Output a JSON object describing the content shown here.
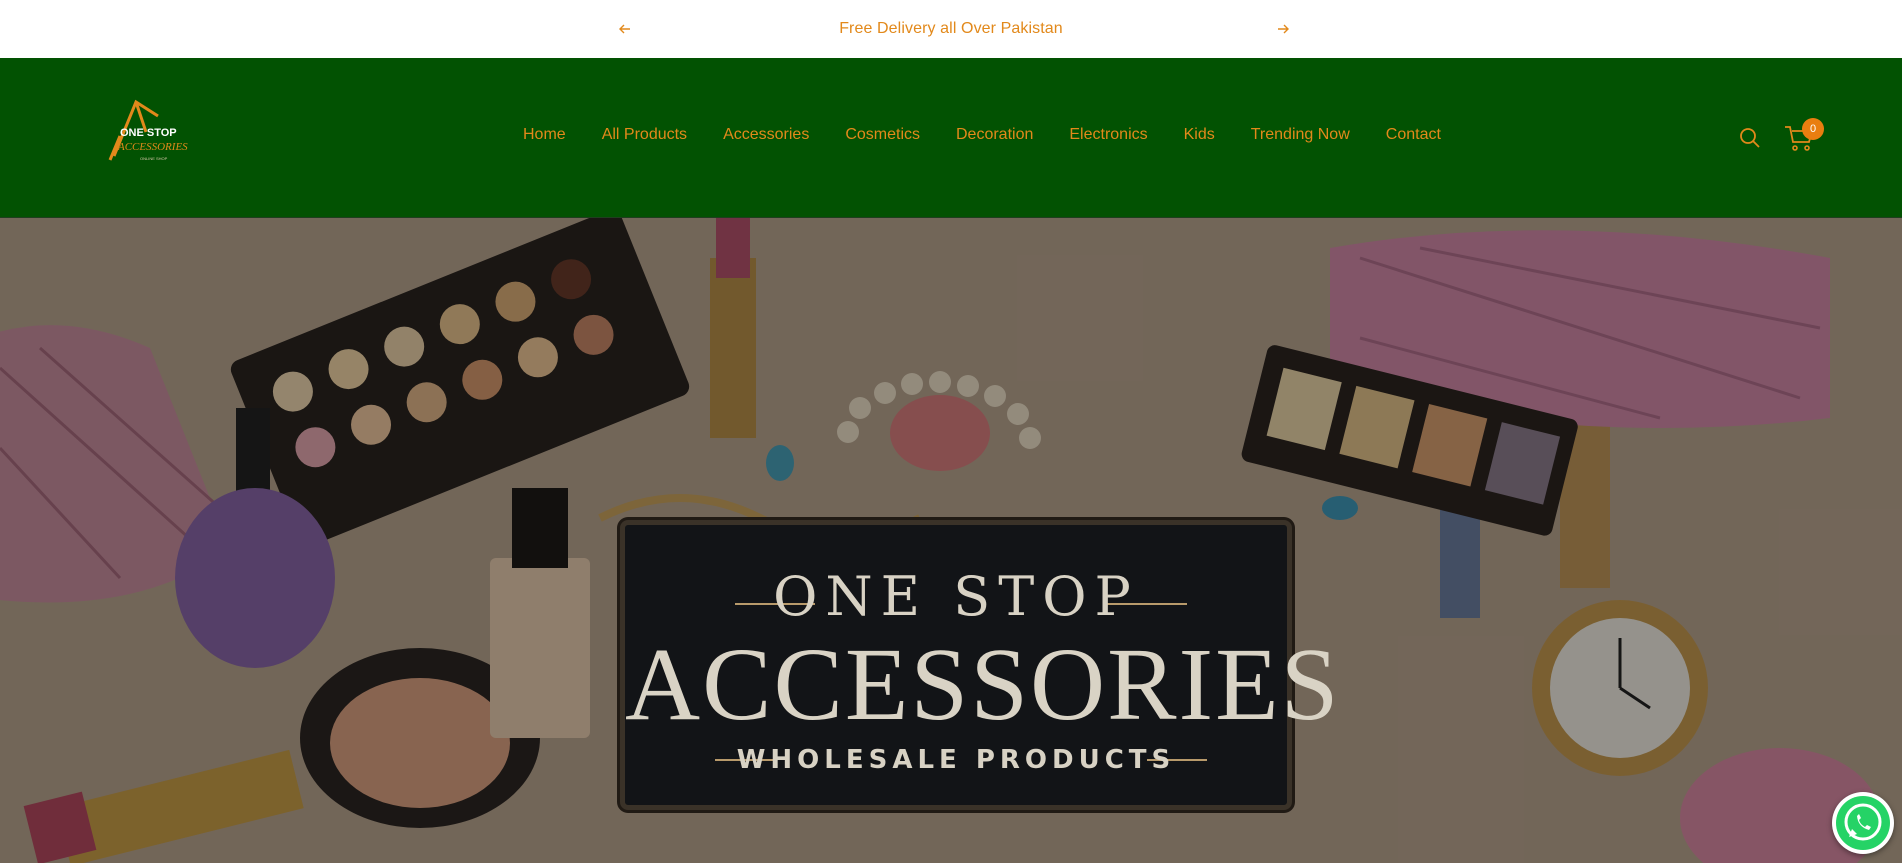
{
  "announcement": {
    "text": "Free Delivery all Over Pakistan",
    "prev_icon": "arrow-left-icon",
    "next_icon": "arrow-right-icon"
  },
  "header": {
    "logo": {
      "line1": "ONE STOP",
      "line2": "ACCESSORIES",
      "line3": "ONLINE SHOP"
    },
    "nav": [
      {
        "label": "Home"
      },
      {
        "label": "All Products"
      },
      {
        "label": "Accessories"
      },
      {
        "label": "Cosmetics"
      },
      {
        "label": "Decoration"
      },
      {
        "label": "Electronics"
      },
      {
        "label": "Kids"
      },
      {
        "label": "Trending Now"
      },
      {
        "label": "Contact"
      }
    ],
    "search_icon": "search-icon",
    "cart_icon": "cart-icon",
    "cart_count": "0"
  },
  "hero": {
    "line1": "ONE STOP",
    "line2": "ACCESSORIES",
    "line3": "WHOLESALE PRODUCTS"
  },
  "floating": {
    "whatsapp_icon": "whatsapp-icon"
  },
  "colors": {
    "header_bg": "#025202",
    "accent": "#e2891b",
    "badge": "#e97e10"
  }
}
